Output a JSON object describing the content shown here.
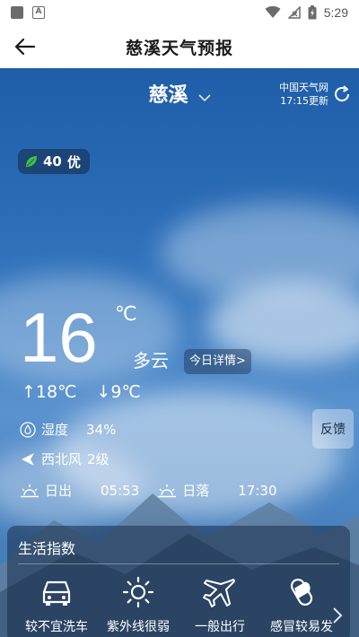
{
  "status_bar": {
    "time": "5:29"
  },
  "app_bar": {
    "title": "慈溪天气预报"
  },
  "location": {
    "city": "慈溪",
    "source": "中国天气网",
    "updated": "17:15更新"
  },
  "aqi": {
    "value": "40",
    "level": "优"
  },
  "current": {
    "temperature": "16",
    "unit": "℃",
    "condition": "多云",
    "detail_button": "今日详情>",
    "high": "↑18℃",
    "low": "↓9℃"
  },
  "details": {
    "humidity_label": "湿度",
    "humidity_value": "34%",
    "wind_label": "西北风",
    "wind_value": "2级",
    "sunrise_label": "日出",
    "sunrise_value": "05:53",
    "sunset_label": "日落",
    "sunset_value": "17:30"
  },
  "feedback_button": "反馈",
  "life_index": {
    "title": "生活指数",
    "items": [
      {
        "label": "较不宜洗车",
        "icon": "car-icon"
      },
      {
        "label": "紫外线很弱",
        "icon": "sun-icon"
      },
      {
        "label": "一般出行",
        "icon": "airplane-icon"
      },
      {
        "label": "感冒较易发",
        "icon": "pill-icon"
      }
    ]
  }
}
